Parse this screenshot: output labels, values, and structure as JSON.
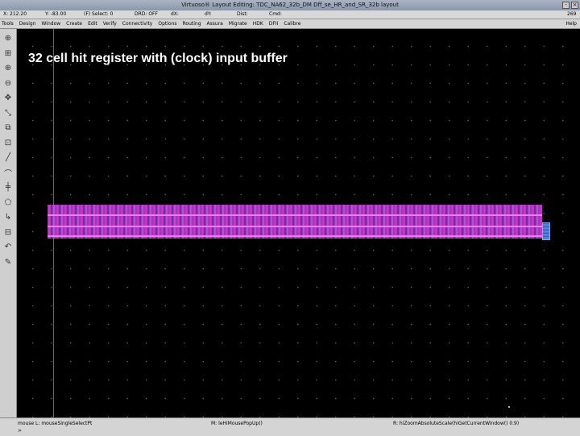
{
  "window": {
    "title": "Virtuoso® Layout Editing: TDC_NA62_32b_DM Dff_se_HR_and_SR_32b layout"
  },
  "status": {
    "x": "X: 212.20",
    "y": "Y: -83.00",
    "select": "(F) Select: 0",
    "drd": "DRD: OFF",
    "dx": "dX:",
    "dy": "dY:",
    "dist": "Dist:",
    "cmd": "Cmd:",
    "right": "269"
  },
  "menu": {
    "items": [
      "Tools",
      "Design",
      "Window",
      "Create",
      "Edit",
      "Verify",
      "Connectivity",
      "Options",
      "Routing",
      "Assura",
      "Migrate",
      "HDK",
      "DFII",
      "Calibre"
    ],
    "help": "Help"
  },
  "toolbar": {
    "icons": [
      "zoom-fit-icon",
      "zoom-area-icon",
      "zoom-in-icon",
      "zoom-out-icon",
      "pan-icon",
      "stretch-icon",
      "copy-icon",
      "move-icon",
      "path-icon",
      "arc-icon",
      "ruler-icon",
      "polygon-icon",
      "label-icon",
      "instance-icon",
      "undo-icon",
      "pencil-icon"
    ],
    "glyphs": [
      "⊕",
      "⊞",
      "⊕",
      "⊖",
      "✥",
      "⤡",
      "⧉",
      "⊡",
      "╱",
      "⌒",
      "╪",
      "⬠",
      "↳",
      "⊟",
      "↶",
      "✎"
    ]
  },
  "canvas": {
    "overlay_text": "32 cell hit register with (clock) input buffer"
  },
  "bottom": {
    "mouse_l": "mouse L: mouseSingleSelectPt",
    "mouse_m": "M: leHiMousePopUp()",
    "mouse_r": "R: hiZoomAbsoluteScale(hiGetCurrentWindow() 0.9)",
    "prompt": ">"
  }
}
